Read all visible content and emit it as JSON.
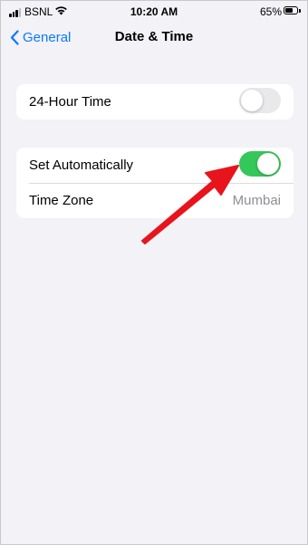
{
  "status_bar": {
    "carrier": "BSNL",
    "time": "10:20 AM",
    "battery_percent_text": "65%",
    "battery_level": 0.65,
    "signal_bars_filled": 3,
    "signal_bars_total": 4,
    "wifi_icon": "wifi-icon",
    "battery_icon": "battery-icon"
  },
  "nav": {
    "back_label": "General",
    "back_icon": "chevron-left-icon",
    "title": "Date & Time"
  },
  "settings": {
    "hour24": {
      "label": "24-Hour Time",
      "enabled": false
    },
    "set_automatically": {
      "label": "Set Automatically",
      "enabled": true
    },
    "time_zone": {
      "label": "Time Zone",
      "value": "Mumbai"
    }
  },
  "colors": {
    "accent": "#0a7aff",
    "toggle_on": "#34c759",
    "toggle_off": "#e9e9eb",
    "background": "#f2f2f7",
    "annotation_arrow": "#e8141c"
  }
}
